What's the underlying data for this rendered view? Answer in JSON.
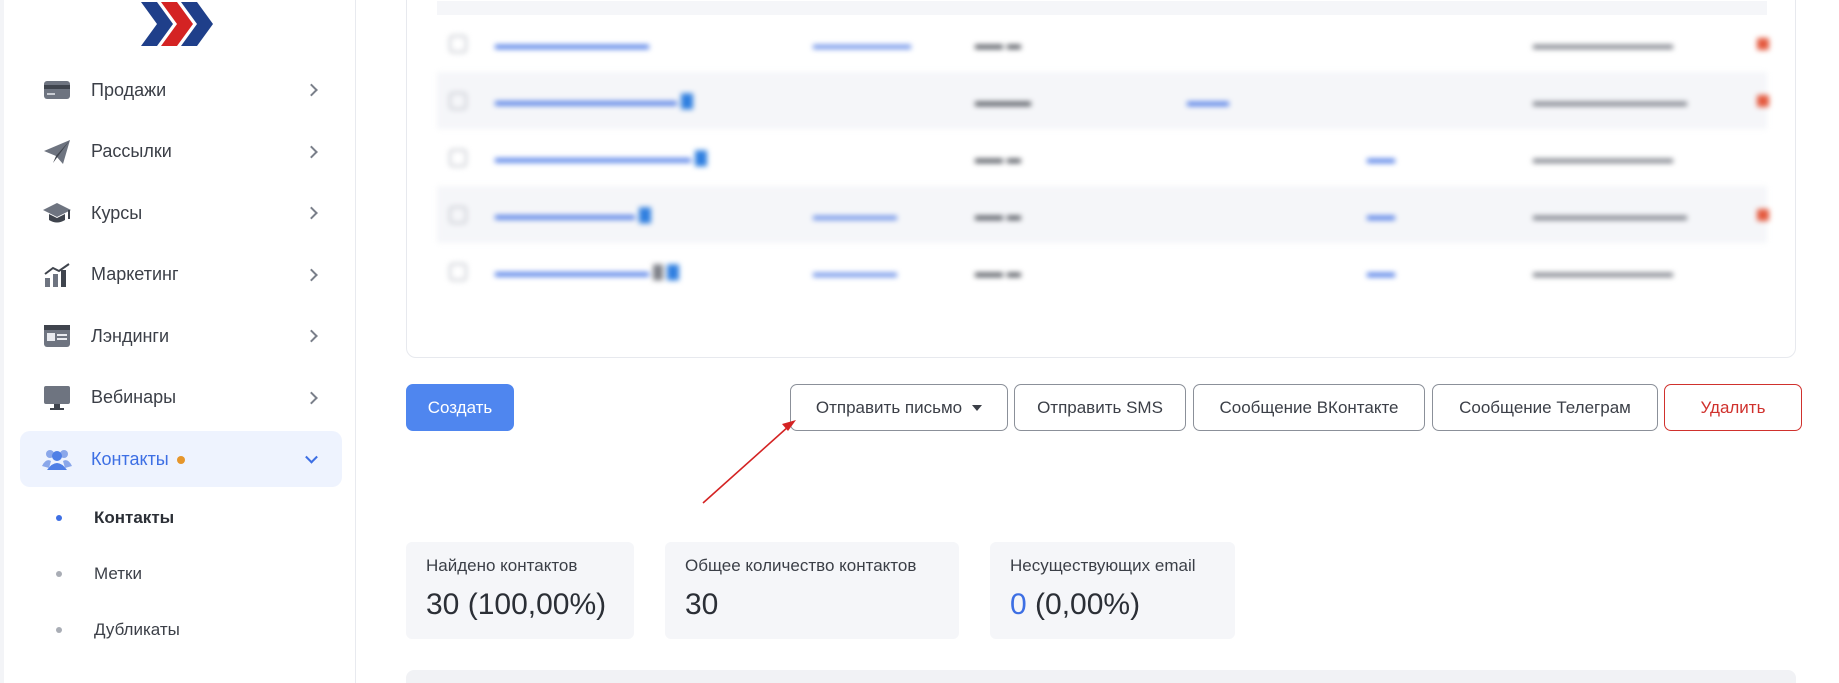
{
  "sidebar": {
    "nav": [
      {
        "label": "Продажи",
        "icon": "card-icon"
      },
      {
        "label": "Рассылки",
        "icon": "paper-plane-icon"
      },
      {
        "label": "Курсы",
        "icon": "graduation-cap-icon"
      },
      {
        "label": "Маркетинг",
        "icon": "growth-chart-icon"
      },
      {
        "label": "Лэндинги",
        "icon": "landing-page-icon"
      },
      {
        "label": "Вебинары",
        "icon": "monitor-icon"
      },
      {
        "label": "Контакты",
        "icon": "users-icon",
        "active": true
      }
    ],
    "subnav": [
      {
        "label": "Контакты",
        "active": true
      },
      {
        "label": "Метки"
      },
      {
        "label": "Дубликаты"
      }
    ]
  },
  "actions": {
    "create": "Создать",
    "send_email": "Отправить письмо",
    "send_sms": "Отправить SMS",
    "vk_message": "Сообщение ВКонтакте",
    "telegram_message": "Сообщение Телеграм",
    "delete": "Удалить"
  },
  "stats": {
    "found": {
      "label": "Найдено контактов",
      "value": "30 (100,00%)"
    },
    "total": {
      "label": "Общее количество контактов",
      "value": "30"
    },
    "invalid": {
      "label": "Несуществующих email",
      "value_count": "0",
      "value_rest": " (0,00%)"
    }
  },
  "colors": {
    "accent": "#4f86ef",
    "danger": "#d0312d",
    "badge": "#e6962b",
    "arrow": "#d42323"
  }
}
